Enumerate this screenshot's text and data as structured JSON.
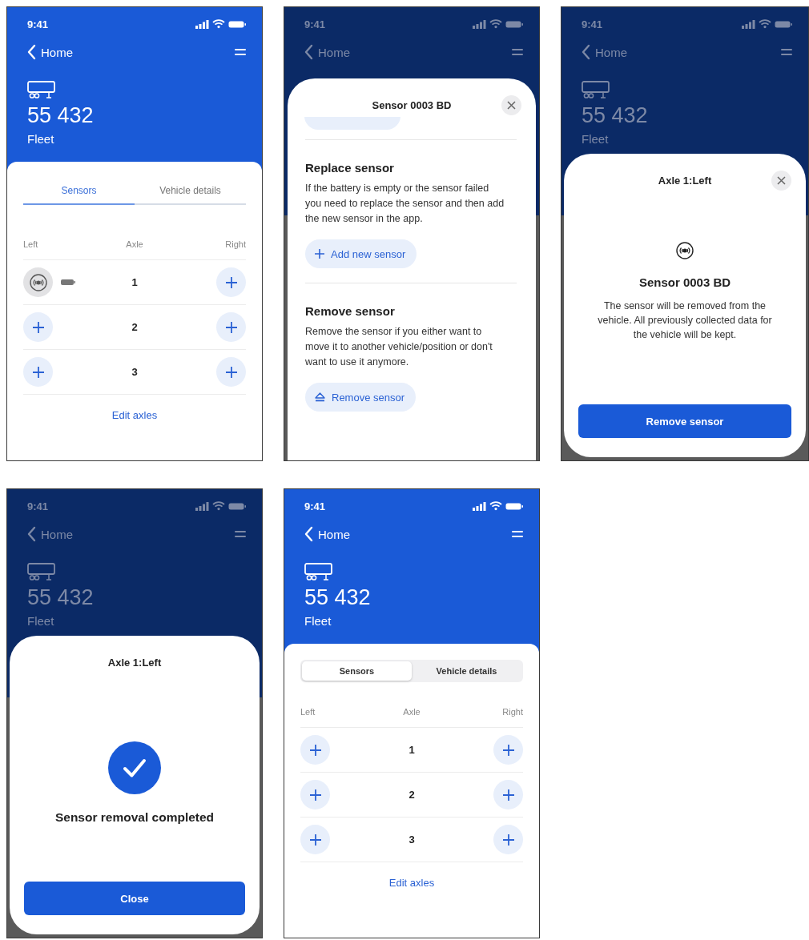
{
  "screens": [
    {
      "kind": "vehicle",
      "dimmed": false,
      "time": "9:41",
      "back": "Home",
      "vehicle": {
        "number": "55 432",
        "group": "Fleet"
      },
      "segmented": false,
      "tabs": [
        {
          "label": "Sensors",
          "selected": true
        },
        {
          "label": "Vehicle details",
          "selected": false
        }
      ],
      "columns": [
        "Left",
        "Axle",
        "Right"
      ],
      "axles": [
        {
          "number": "1",
          "left_sensor": true,
          "right_sensor": false
        },
        {
          "number": "2",
          "left_sensor": false,
          "right_sensor": false
        },
        {
          "number": "3",
          "left_sensor": false,
          "right_sensor": false
        }
      ],
      "edit_link": "Edit axles"
    },
    {
      "kind": "sensor_options",
      "dimmed": true,
      "time": "9:41",
      "back": "Home",
      "sheet": {
        "title": "Sensor 0003 BD",
        "closable": true,
        "scrolled": true,
        "sections": [
          {
            "heading": "Replace sensor",
            "text": "If the battery is empty or the sensor failed you need to replace the sensor and then add the new sensor in the app.",
            "kind": "replace",
            "button": "Add new sensor"
          },
          {
            "heading": "Remove sensor",
            "text": "Remove the sensor if you either want to move it to another vehicle/position or don't want to use it anymore.",
            "kind": "remove",
            "button": "Remove sensor"
          }
        ]
      }
    },
    {
      "kind": "remove_confirm",
      "dimmed": true,
      "time": "9:41",
      "back": "Home",
      "vehicle": {
        "number": "55 432",
        "group": "Fleet"
      },
      "sheet": {
        "title": "Axle 1:Left",
        "closable": true,
        "sensor_name": "Sensor 0003 BD",
        "text": "The sensor will be removed from the vehicle. All previously collected data for the vehicle will be kept.",
        "action": "Remove sensor"
      }
    },
    {
      "kind": "removal_done",
      "dimmed": true,
      "time": "9:41",
      "back": "Home",
      "vehicle": {
        "number": "55 432",
        "group": "Fleet"
      },
      "sheet": {
        "title": "Axle 1:Left",
        "closable": false,
        "message": "Sensor removal completed",
        "action": "Close"
      }
    },
    {
      "kind": "vehicle",
      "dimmed": false,
      "time": "9:41",
      "back": "Home",
      "vehicle": {
        "number": "55 432",
        "group": "Fleet"
      },
      "segmented": true,
      "tabs": [
        {
          "label": "Sensors",
          "selected": true
        },
        {
          "label": "Vehicle details",
          "selected": false
        }
      ],
      "columns": [
        "Left",
        "Axle",
        "Right"
      ],
      "axles": [
        {
          "number": "1",
          "left_sensor": false,
          "right_sensor": false
        },
        {
          "number": "2",
          "left_sensor": false,
          "right_sensor": false
        },
        {
          "number": "3",
          "left_sensor": false,
          "right_sensor": false
        }
      ],
      "edit_link": "Edit axles"
    }
  ]
}
